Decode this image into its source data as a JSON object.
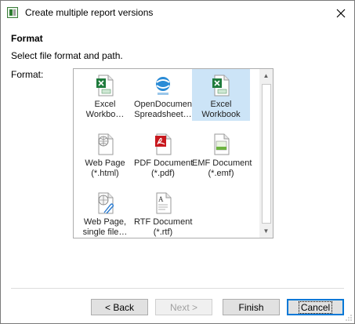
{
  "window": {
    "title": "Create multiple report versions"
  },
  "page": {
    "heading": "Format",
    "subheading": "Select file format and path.",
    "format_label": "Format:"
  },
  "formats": [
    {
      "name": "Excel Workbook (truncated)",
      "line1": "Excel",
      "line2": "Workbo…",
      "icon": "excel-icon",
      "selected": false
    },
    {
      "name": "OpenDocument Spreadsheet",
      "line1": "OpenDocument",
      "line2": "Spreadsheet…",
      "icon": "opendocument-icon",
      "selected": false
    },
    {
      "name": "Excel Workbook",
      "line1": "Excel",
      "line2": "Workbook",
      "icon": "excel-icon",
      "selected": true
    },
    {
      "name": "Web Page",
      "line1": "Web Page",
      "line2": "(*.html)",
      "icon": "web-page-icon",
      "selected": false
    },
    {
      "name": "PDF Document",
      "line1": "PDF Document",
      "line2": "(*.pdf)",
      "icon": "pdf-icon",
      "selected": false
    },
    {
      "name": "EMF Document",
      "line1": "EMF Document",
      "line2": "(*.emf)",
      "icon": "emf-icon",
      "selected": false
    },
    {
      "name": "Web Page, single file",
      "line1": "Web Page,",
      "line2": "single file…",
      "icon": "web-archive-icon",
      "selected": false
    },
    {
      "name": "RTF Document",
      "line1": "RTF Document",
      "line2": "(*.rtf)",
      "icon": "rtf-icon",
      "selected": false
    }
  ],
  "buttons": {
    "back": "< Back",
    "next": "Next >",
    "finish": "Finish",
    "cancel": "Cancel"
  },
  "colors": {
    "selection": "#cce4f7",
    "accent": "#0078d7"
  }
}
